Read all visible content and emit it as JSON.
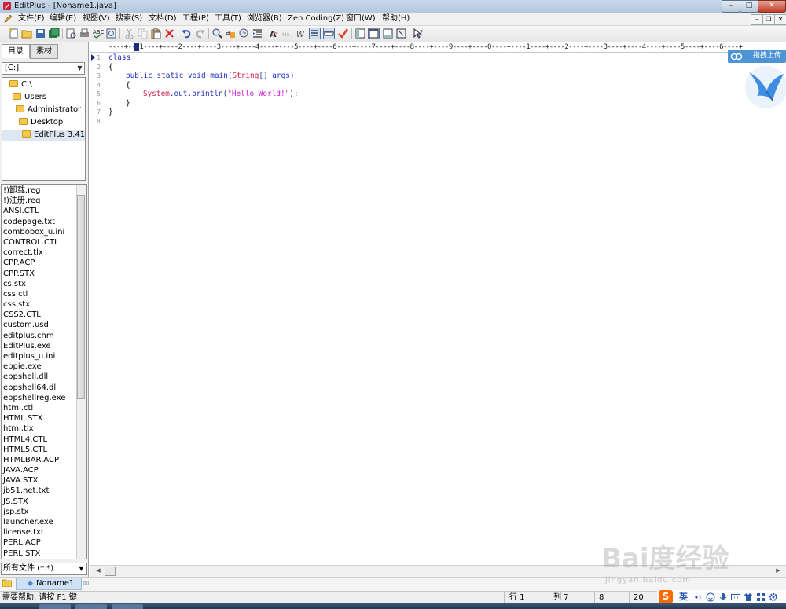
{
  "window": {
    "title": "EditPlus - [Noname1.java]",
    "min_glyph": "–",
    "max_glyph": "□",
    "close_glyph": "✕"
  },
  "menu": {
    "items": [
      "文件(F)",
      "编辑(E)",
      "视图(V)",
      "搜索(S)",
      "文档(D)",
      "工程(P)",
      "工具(T)",
      "浏览器(B)",
      "Zen Coding(Z)",
      "窗口(W)",
      "帮助(H)"
    ],
    "mdi_min": "–",
    "mdi_restore": "❐",
    "mdi_close": "✕"
  },
  "toolbar": {
    "icons": [
      "new-file-icon",
      "open-icon",
      "save-icon",
      "save-all-icon",
      "print-preview-icon",
      "print-icon",
      "spell-check-icon",
      "browser-icon",
      "cut-icon",
      "copy-icon",
      "paste-icon",
      "delete-icon",
      "undo-icon",
      "redo-icon",
      "find-icon",
      "replace-icon",
      "goto-icon",
      "indent-icon",
      "font-icon",
      "hex-icon",
      "word-wrap-icon",
      "line-number-icon",
      "ruler-icon",
      "check-icon",
      "panel-icon",
      "toolbar-icon",
      "output-icon",
      "fullscreen-icon",
      "help-icon"
    ]
  },
  "left_panel": {
    "tabs": [
      "目录",
      "素材"
    ],
    "drive": "[C:]",
    "folders": [
      "C:\\",
      "Users",
      "Administrator",
      "Desktop",
      "EditPlus 3.41"
    ],
    "selected_folder": "EditPlus 3.41",
    "files": [
      "!)卸载.reg",
      "!)注册.reg",
      "ANSI.CTL",
      "codepage.txt",
      "combobox_u.ini",
      "CONTROL.CTL",
      "correct.tlx",
      "CPP.ACP",
      "CPP.STX",
      "cs.stx",
      "css.ctl",
      "css.stx",
      "CSS2.CTL",
      "custom.usd",
      "editplus.chm",
      "EditPlus.exe",
      "editplus_u.ini",
      "eppie.exe",
      "eppshell.dll",
      "eppshell64.dll",
      "eppshellreg.exe",
      "html.ctl",
      "HTML.STX",
      "html.tlx",
      "HTML4.CTL",
      "HTML5.CTL",
      "HTMLBAR.ACP",
      "JAVA.ACP",
      "JAVA.STX",
      "jb51.net.txt",
      "JS.STX",
      "jsp.stx",
      "launcher.exe",
      "license.txt",
      "PERL.ACP",
      "PERL.STX"
    ],
    "filter": "所有文件 (*.*)"
  },
  "editor": {
    "ruler": "----+---1----+----2----+----3----+----4----+----5----+----6----+----7----+----8----+----9----+----0----+----1----+----2----+----3----+----4----+----5----+----6----+",
    "line_numbers": [
      "1",
      "2",
      "3",
      "4",
      "5",
      "6",
      "7",
      "8"
    ],
    "code": {
      "l1": "class",
      "l2": "{",
      "l3_kw": "public static void main(",
      "l3_cls": "String",
      "l3_rest": "[] args)",
      "l4": "{",
      "l5_cls": "System",
      "l5_mid": ".out.println(",
      "l5_str": "\"Hello World!\"",
      "l5_end": ");",
      "l6": "}",
      "l7": "}"
    }
  },
  "float_widget": {
    "upload_label": "拖拽上传"
  },
  "doc_tab": {
    "label": "Noname1",
    "close": "☒"
  },
  "status": {
    "help": "需要帮助, 请按 F1 键",
    "line": "行 1",
    "col": "列 7",
    "num1": "8",
    "num2": "20"
  },
  "ime": {
    "logo": "S",
    "lang": "英"
  },
  "watermark": {
    "text": "Bai度经验",
    "sub": "jingyan.baidu.com"
  },
  "colors": {
    "keyword": "#1e2fbe",
    "class_name": "#d0224a",
    "string": "#d01ad7"
  }
}
